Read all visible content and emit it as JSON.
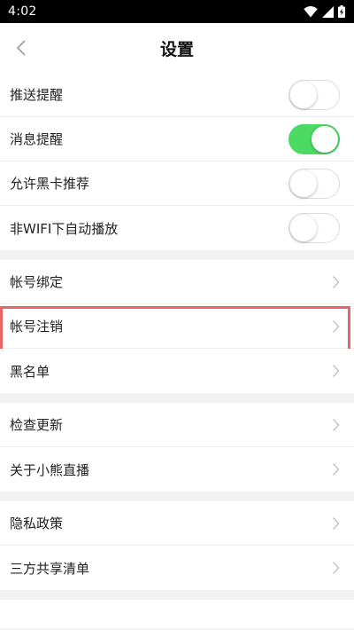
{
  "status_bar": {
    "time": "4:02"
  },
  "header": {
    "title": "设置"
  },
  "groups": [
    {
      "items": [
        {
          "label": "推送提醒",
          "type": "toggle",
          "on": false
        },
        {
          "label": "消息提醒",
          "type": "toggle",
          "on": true
        },
        {
          "label": "允许黑卡推荐",
          "type": "toggle",
          "on": false
        },
        {
          "label": "非WIFI下自动播放",
          "type": "toggle",
          "on": false
        }
      ]
    },
    {
      "items": [
        {
          "label": "帐号绑定",
          "type": "link"
        },
        {
          "label": "帐号注销",
          "type": "link",
          "highlighted": true
        },
        {
          "label": "黑名单",
          "type": "link"
        }
      ]
    },
    {
      "items": [
        {
          "label": "检查更新",
          "type": "link"
        },
        {
          "label": "关于小熊直播",
          "type": "link"
        }
      ]
    },
    {
      "items": [
        {
          "label": "隐私政策",
          "type": "link"
        },
        {
          "label": "三方共享清单",
          "type": "link"
        }
      ]
    }
  ],
  "colors": {
    "toggle_on": "#4cd964",
    "highlight_border": "#e96464",
    "background": "#f2f2f2"
  }
}
